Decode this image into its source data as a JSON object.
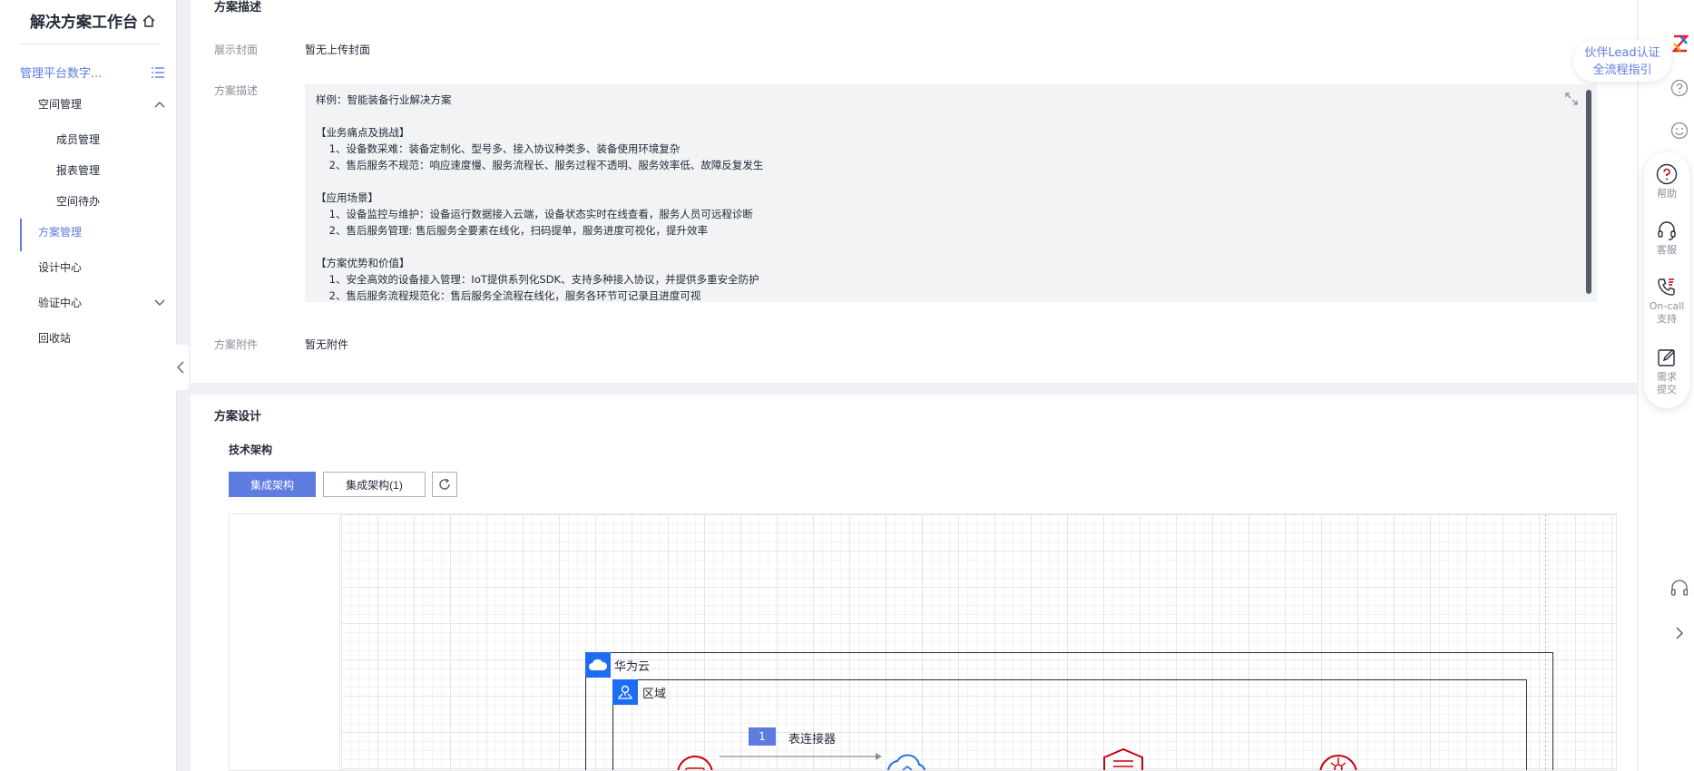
{
  "sidebar": {
    "title": "解决方案工作台",
    "space_name": "管理平台数字...",
    "items": [
      {
        "label": "空间管理"
      },
      {
        "label": "成员管理"
      },
      {
        "label": "报表管理"
      },
      {
        "label": "空间待办"
      },
      {
        "label": "方案管理"
      },
      {
        "label": "设计中心"
      },
      {
        "label": "验证中心"
      },
      {
        "label": "回收站"
      }
    ]
  },
  "description_section": {
    "title": "方案描述",
    "cover_label": "展示封面",
    "cover_value": "暂无上传封面",
    "desc_label": "方案描述",
    "desc_lines": [
      "样例：智能装备行业解决方案",
      "",
      "【业务痛点及挑战】",
      "    1、设备数采难：装备定制化、型号多、接入协议种类多、装备使用环境复杂",
      "    2、售后服务不规范：响应速度慢、服务流程长、服务过程不透明、服务效率低、故障反复发生",
      "",
      "【应用场景】",
      "    1、设备监控与维护：设备运行数据接入云端，设备状态实时在线查看，服务人员可远程诊断",
      "    2、售后服务管理: 售后服务全要素在线化，扫码提单，服务进度可视化，提升效率",
      "",
      "【方案优势和价值】",
      "    1、安全高效的设备接入管理：IoT提供系列化SDK、支持多种接入协议，并提供多重安全防护",
      "    2、售后服务流程规范化：售后服务全流程在线化，服务各环节可记录且进度可视"
    ],
    "attachment_label": "方案附件",
    "attachment_value": "暂无附件"
  },
  "design_section": {
    "title": "方案设计",
    "subtitle": "技术架构",
    "tab_active": "集成架构",
    "tab_other": "集成架构(1)",
    "diagram": {
      "cloud_label": "华为云",
      "region_label": "区域",
      "badge": "1",
      "connector_label": "表连接器"
    }
  },
  "rightbar": {
    "partner_line1": "伙伴Lead认证",
    "partner_line2": "全流程指引",
    "help": "帮助",
    "service": "客服",
    "oncall_1": "On-call",
    "oncall_2": "支持",
    "req_1": "需求",
    "req_2": "提交"
  },
  "colors": {
    "accent": "#5e7ce0",
    "cloud_blue": "#1d6df2",
    "icon_red": "#c7000b"
  }
}
